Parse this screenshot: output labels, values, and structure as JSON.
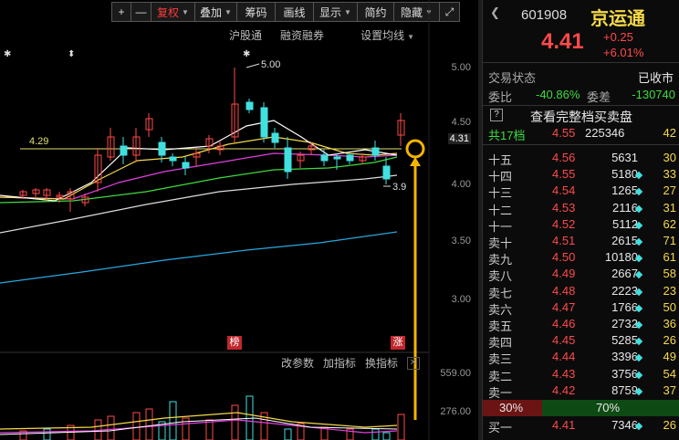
{
  "toolbar": {
    "plus": "+",
    "minus": "—",
    "restore_rights": "复权",
    "overlay": "叠加",
    "chips": "筹码",
    "draw_line": "画线",
    "display": "显示",
    "brief": "简约",
    "hide": "隐藏"
  },
  "subbar": {
    "hk_connect": "沪股通",
    "margin": "融资融券",
    "set_ma": "设置均线"
  },
  "price_axis": [
    "5.00",
    "4.50",
    "4.31",
    "4.00",
    "3.50",
    "3.00"
  ],
  "annotations": {
    "high_label": "5.00",
    "low_label": "3.9",
    "ref_line_label": "4.29",
    "star": "✱",
    "arrow": "⬍"
  },
  "badges": {
    "list": "榜",
    "rise": "涨"
  },
  "volume": {
    "tools": [
      "改参数",
      "加指标",
      "换指标"
    ],
    "axis": [
      "559.00",
      "276.00"
    ]
  },
  "colors": {
    "up": "#ff4a4a",
    "down": "#40e0e0",
    "ma5": "#ffffff",
    "ma10": "#f5d94a",
    "ma20": "#e040e0",
    "ma30": "#3ddb3d",
    "ma60": "#dddddd",
    "ma120": "#29a8e0",
    "ref": "#e0e070",
    "annotation": "#f5b400"
  },
  "stock": {
    "code": "601908",
    "name": "京运通",
    "price": "4.41",
    "change": "+0.25",
    "change_pct": "+6.01%"
  },
  "status": {
    "label": "交易状态",
    "value": "已收市"
  },
  "ratio": {
    "label": "委比",
    "value": "-40.86%",
    "diff_label": "委差",
    "diff_value": "-130740"
  },
  "full_book": {
    "icon": "?",
    "text": "查看完整档买卖盘"
  },
  "total": {
    "label": "共17档",
    "price": "4.55",
    "volume": "225346",
    "count": "42"
  },
  "asks": [
    {
      "label": "十五",
      "price": "4.56",
      "volume": "5631",
      "count": "30",
      "dot": false
    },
    {
      "label": "十四",
      "price": "4.55",
      "volume": "5180",
      "count": "33",
      "dot": true
    },
    {
      "label": "十三",
      "price": "4.54",
      "volume": "1265",
      "count": "27",
      "dot": true
    },
    {
      "label": "十二",
      "price": "4.53",
      "volume": "2116",
      "count": "31",
      "dot": true
    },
    {
      "label": "十一",
      "price": "4.52",
      "volume": "5112",
      "count": "62",
      "dot": true
    },
    {
      "label": "卖十",
      "price": "4.51",
      "volume": "2615",
      "count": "71",
      "dot": true
    },
    {
      "label": "卖九",
      "price": "4.50",
      "volume": "10180",
      "count": "61",
      "dot": true
    },
    {
      "label": "卖八",
      "price": "4.49",
      "volume": "2667",
      "count": "58",
      "dot": true
    },
    {
      "label": "卖七",
      "price": "4.48",
      "volume": "2223",
      "count": "23",
      "dot": true
    },
    {
      "label": "卖六",
      "price": "4.47",
      "volume": "1766",
      "count": "50",
      "dot": true
    },
    {
      "label": "卖五",
      "price": "4.46",
      "volume": "2732",
      "count": "36",
      "dot": true
    },
    {
      "label": "卖四",
      "price": "4.45",
      "volume": "5285",
      "count": "26",
      "dot": true
    },
    {
      "label": "卖三",
      "price": "4.44",
      "volume": "3396",
      "count": "49",
      "dot": true
    },
    {
      "label": "卖二",
      "price": "4.43",
      "volume": "3756",
      "count": "54",
      "dot": true
    },
    {
      "label": "卖一",
      "price": "4.42",
      "volume": "8759",
      "count": "37",
      "dot": true
    }
  ],
  "bar_ratio": {
    "left": "30%",
    "right": "70%",
    "left_frac": 0.3
  },
  "bids": [
    {
      "label": "买一",
      "price": "4.41",
      "volume": "7346",
      "count": "26",
      "dot": true
    }
  ]
}
